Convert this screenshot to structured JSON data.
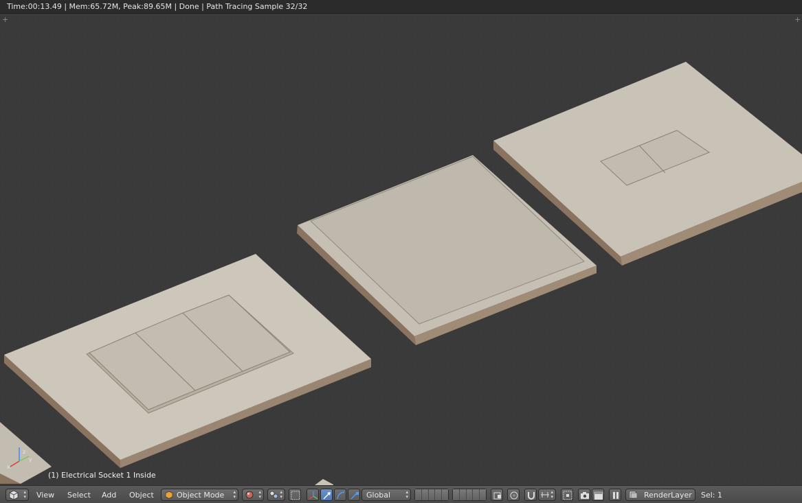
{
  "status": {
    "time": "Time:00:13.49",
    "mem": "Mem:65.72M, Peak:89.65M",
    "state": "Done",
    "progress": "Path Tracing Sample 32/32",
    "full": "Time:00:13.49 | Mem:65.72M, Peak:89.65M | Done | Path Tracing Sample 32/32"
  },
  "viewport": {
    "object_info": "(1) Electrical Socket 1 Inside",
    "background_color": "#3a3a3a",
    "model_color": "#b9b0a4"
  },
  "header": {
    "menus": [
      "View",
      "Select",
      "Add",
      "Object"
    ],
    "mode": "Object Mode",
    "orientation": "Global",
    "render_layer": "RenderLayer",
    "selection": "Sel: 1"
  },
  "icons": {
    "editor_type": "cube-icon",
    "viewport_shading": "sphere-icon",
    "pivot": "pivot-icon",
    "manipulator": "axis-icon",
    "translate": "arrow-icon",
    "rotate": "rotate-icon",
    "scale": "scale-icon",
    "snap": "magnet-icon",
    "proportional": "circle-icon",
    "render": "camera-icon",
    "anim": "clapper-icon"
  }
}
